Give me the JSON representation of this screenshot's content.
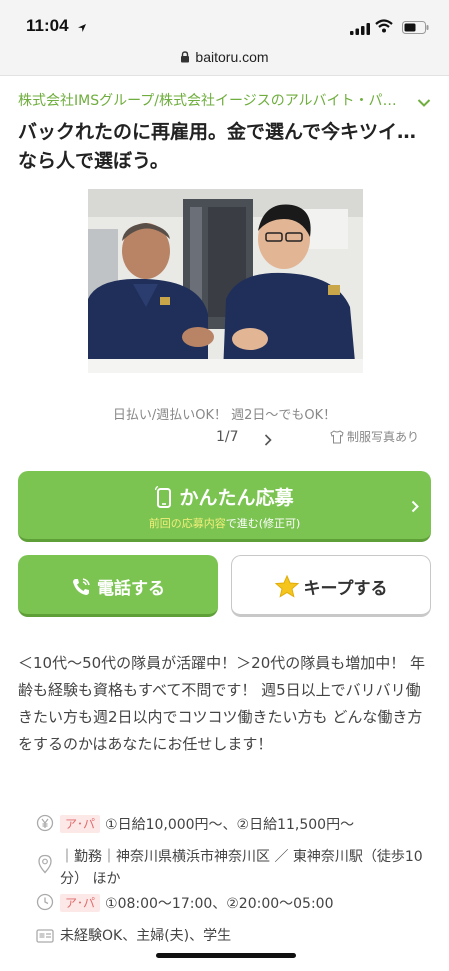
{
  "status_bar": {
    "time": "11:04"
  },
  "browser": {
    "url": "baitoru.com"
  },
  "company": "株式会社IMSグループ/株式会社イージスのアルバイト・パート",
  "headline": "バックれたのに再雇用。金で選んで今キツイ…なら人で選ぼう。",
  "photo": {
    "caption": "日払い/週払いOK！ 週2日～でもOK！",
    "pager": "1/7",
    "uniform_note": "制服写真あり"
  },
  "apply": {
    "label": "かんたん応募",
    "sub_highlight": "前回の応募内容",
    "sub_rest": "で進む(修正可)"
  },
  "call_label": "電話する",
  "keep_label": "キープする",
  "intro": "＜10代～50代の隊員が活躍中！＞20代の隊員も増加中！ 年齢も経験も資格もすべて不問です！ 週5日以上でバリバリ働きたい方も週2日以内でコツコツ働きたい方も どんな働き方をするのかはあなたにお任せします！",
  "info": {
    "pay_tag": "ア･パ",
    "pay": "①日給10,000円～、②日給11,500円～",
    "location": "｜勤務｜神奈川県横浜市神奈川区 ／ 東神奈川駅（徒歩10分） ほか",
    "hours_tag": "ア･パ",
    "hours": "①08:00～17:00、②20:00～05:00",
    "features": "未経験OK、主婦(夫)、学生"
  },
  "colors": {
    "brand_green": "#7cc452",
    "tag_bg": "#fde8e8",
    "tag_text": "#e06c6c"
  }
}
